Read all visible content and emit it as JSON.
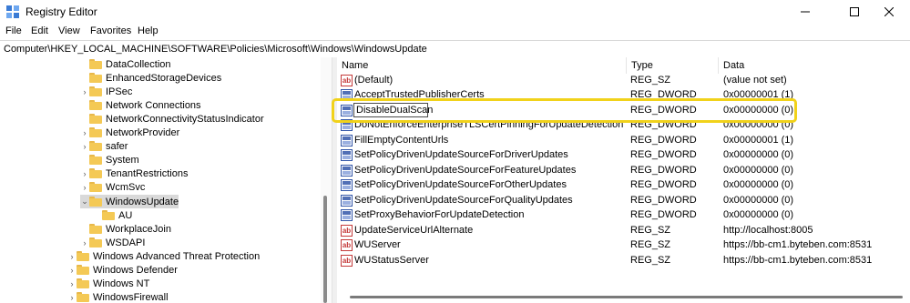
{
  "window": {
    "title": "Registry Editor"
  },
  "menu": [
    "File",
    "Edit",
    "View",
    "Favorites",
    "Help"
  ],
  "address": "Computer\\HKEY_LOCAL_MACHINE\\SOFTWARE\\Policies\\Microsoft\\Windows\\WindowsUpdate",
  "tree": [
    {
      "label": "DataCollection",
      "chevron": "",
      "level": 1
    },
    {
      "label": "EnhancedStorageDevices",
      "chevron": "",
      "level": 1
    },
    {
      "label": "IPSec",
      "chevron": "›",
      "level": 1
    },
    {
      "label": "Network Connections",
      "chevron": "",
      "level": 1
    },
    {
      "label": "NetworkConnectivityStatusIndicator",
      "chevron": "",
      "level": 1
    },
    {
      "label": "NetworkProvider",
      "chevron": "›",
      "level": 1
    },
    {
      "label": "safer",
      "chevron": "›",
      "level": 1
    },
    {
      "label": "System",
      "chevron": "",
      "level": 1
    },
    {
      "label": "TenantRestrictions",
      "chevron": "›",
      "level": 1
    },
    {
      "label": "WcmSvc",
      "chevron": "›",
      "level": 1
    },
    {
      "label": "WindowsUpdate",
      "chevron": "⌄",
      "level": 1,
      "selected": true
    },
    {
      "label": "AU",
      "chevron": "",
      "level": 2
    },
    {
      "label": "WorkplaceJoin",
      "chevron": "",
      "level": 1
    },
    {
      "label": "WSDAPI",
      "chevron": "›",
      "level": 1
    },
    {
      "label": "Windows Advanced Threat Protection",
      "chevron": "›",
      "level": 0
    },
    {
      "label": "Windows Defender",
      "chevron": "›",
      "level": 0
    },
    {
      "label": "Windows NT",
      "chevron": "›",
      "level": 0
    },
    {
      "label": "WindowsFirewall",
      "chevron": "›",
      "level": 0
    }
  ],
  "list": {
    "columns": [
      "Name",
      "Type",
      "Data"
    ],
    "rows": [
      {
        "icon": "ab",
        "name": "(Default)",
        "type": "REG_SZ",
        "data": "(value not set)"
      },
      {
        "icon": "dword",
        "name": "AcceptTrustedPublisherCerts",
        "type": "REG_DWORD",
        "data": "0x00000001 (1)"
      },
      {
        "icon": "dword",
        "name": "DisableDualScan",
        "type": "REG_DWORD",
        "data": "0x00000000 (0)",
        "editing": true
      },
      {
        "icon": "dword",
        "name": "DoNotEnforceEnterpriseTLSCertPinningForUpdateDetection",
        "type": "REG_DWORD",
        "data": "0x00000000 (0)"
      },
      {
        "icon": "dword",
        "name": "FillEmptyContentUrls",
        "type": "REG_DWORD",
        "data": "0x00000001 (1)"
      },
      {
        "icon": "dword",
        "name": "SetPolicyDrivenUpdateSourceForDriverUpdates",
        "type": "REG_DWORD",
        "data": "0x00000000 (0)"
      },
      {
        "icon": "dword",
        "name": "SetPolicyDrivenUpdateSourceForFeatureUpdates",
        "type": "REG_DWORD",
        "data": "0x00000000 (0)"
      },
      {
        "icon": "dword",
        "name": "SetPolicyDrivenUpdateSourceForOtherUpdates",
        "type": "REG_DWORD",
        "data": "0x00000000 (0)"
      },
      {
        "icon": "dword",
        "name": "SetPolicyDrivenUpdateSourceForQualityUpdates",
        "type": "REG_DWORD",
        "data": "0x00000000 (0)"
      },
      {
        "icon": "dword",
        "name": "SetProxyBehaviorForUpdateDetection",
        "type": "REG_DWORD",
        "data": "0x00000000 (0)"
      },
      {
        "icon": "ab",
        "name": "UpdateServiceUrlAlternate",
        "type": "REG_SZ",
        "data": "http://localhost:8005"
      },
      {
        "icon": "ab",
        "name": "WUServer",
        "type": "REG_SZ",
        "data": "https://bb-cm1.byteben.com:8531"
      },
      {
        "icon": "ab",
        "name": "WUStatusServer",
        "type": "REG_SZ",
        "data": "https://bb-cm1.byteben.com:8531"
      }
    ]
  },
  "icons": {
    "app": "registry-editor-icon",
    "string_value": "string-value-icon",
    "dword_value": "dword-value-icon",
    "folder": "folder-icon"
  },
  "colors": {
    "highlight": "#f1d21a",
    "folder": "#f4c955",
    "selected_row": "#d9d9d9"
  }
}
